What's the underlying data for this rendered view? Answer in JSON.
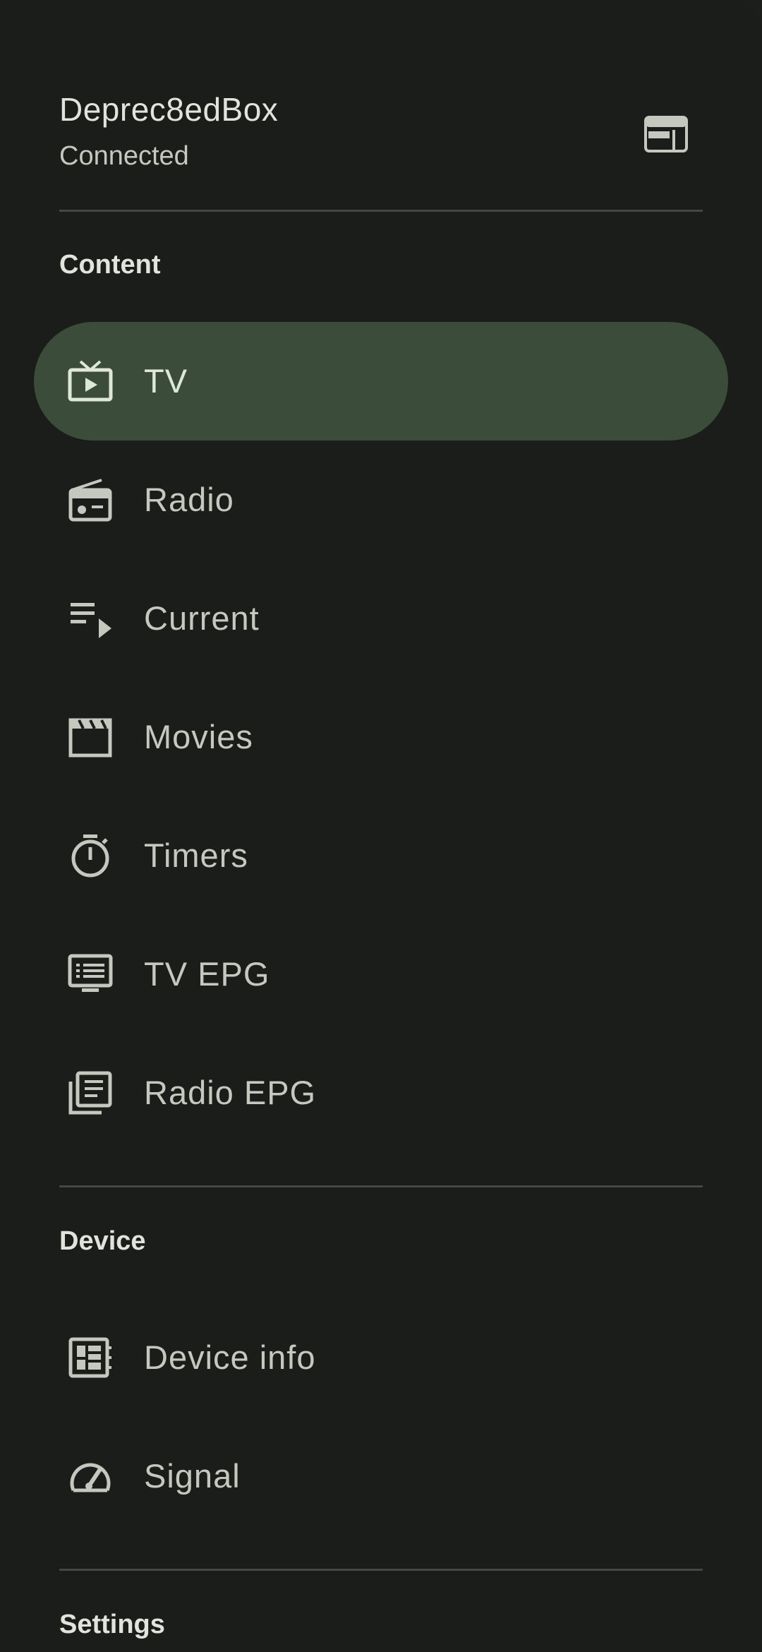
{
  "header": {
    "box_name": "Deprec8edBox",
    "status": "Connected",
    "switch_icon": "dashboard-web-icon"
  },
  "sections": {
    "content": {
      "title": "Content",
      "items": [
        {
          "label": "TV",
          "icon": "live-tv-icon",
          "active": true
        },
        {
          "label": "Radio",
          "icon": "radio-icon",
          "active": false
        },
        {
          "label": "Current",
          "icon": "playlist-play-icon",
          "active": false
        },
        {
          "label": "Movies",
          "icon": "movie-clapper-icon",
          "active": false
        },
        {
          "label": "Timers",
          "icon": "timer-icon",
          "active": false
        },
        {
          "label": "TV EPG",
          "icon": "tv-guide-icon",
          "active": false
        },
        {
          "label": "Radio EPG",
          "icon": "radio-guide-icon",
          "active": false
        }
      ]
    },
    "device": {
      "title": "Device",
      "items": [
        {
          "label": "Device info",
          "icon": "device-info-icon",
          "active": false
        },
        {
          "label": "Signal",
          "icon": "speedometer-icon",
          "active": false
        }
      ]
    },
    "settings": {
      "title": "Settings"
    }
  },
  "colors": {
    "background": "#1a1d19",
    "active_pill": "#3b4d3a",
    "text_primary": "#e1e4dc",
    "text_secondary": "#c4c8bf",
    "divider": "#434841"
  }
}
